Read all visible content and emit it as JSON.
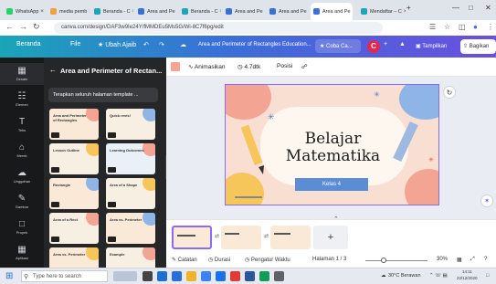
{
  "browser": {
    "tabs": [
      {
        "label": "WhatsApp",
        "color": "#25d366"
      },
      {
        "label": "media pemb",
        "color": "#f2a23a"
      },
      {
        "label": "Beranda - C",
        "color": "#1aa5b8"
      },
      {
        "label": "Area and Pe",
        "color": "#3a6fd8"
      },
      {
        "label": "Beranda - C",
        "color": "#1aa5b8"
      },
      {
        "label": "Area and Pe",
        "color": "#3a6fd8"
      },
      {
        "label": "Area and Pe",
        "color": "#3a6fd8"
      },
      {
        "label": "Area and Pe",
        "color": "#3a6fd8"
      },
      {
        "label": "Mendaftar – C",
        "color": "#1aa5b8"
      }
    ],
    "new_tab": "+",
    "url": "canva.com/design/DAF3w9Ie24Y/fMMDEu5Ms5G/Wi-8C7f6pg/edit"
  },
  "canva_bar": {
    "home": "Beranda",
    "file": "File",
    "resize": "Ubah Ajaib",
    "doc_title": "Area and Perimeter of Rectangles Education...",
    "try_pro": "Coba Ca...",
    "avatar": "C",
    "present": "Tampilkan",
    "share": "Bagikan"
  },
  "rail": [
    {
      "icon": "▦",
      "label": "Desain"
    },
    {
      "icon": "☷",
      "label": "Elemen"
    },
    {
      "icon": "T",
      "label": "Teks"
    },
    {
      "icon": "⌂",
      "label": "Merek"
    },
    {
      "icon": "☁",
      "label": "Unggahan"
    },
    {
      "icon": "✎",
      "label": "Gambar"
    },
    {
      "icon": "□",
      "label": "Proyek"
    },
    {
      "icon": "▦",
      "label": "Aplikasi"
    }
  ],
  "panel": {
    "title": "Area and Perimeter of Rectan...",
    "apply_all": "Terapkan seluruh halaman template ...",
    "thumbs": [
      {
        "title": "Area and Perimeter of Rectangles",
        "bg": "#fbe9d8"
      },
      {
        "title": "Quick revis!",
        "bg": "#f8efe3"
      },
      {
        "title": "Lesson Outline",
        "bg": "#f8efe3"
      },
      {
        "title": "Learning Outcomes",
        "bg": "#e9f0f8"
      },
      {
        "title": "Rectangle",
        "bg": "#fbe9d8"
      },
      {
        "title": "Area of a Shape",
        "bg": "#f8efe3"
      },
      {
        "title": "Area of a Rect",
        "bg": "#f8efe3"
      },
      {
        "title": "Area vs. Perimeter",
        "bg": "#fbe9d8"
      },
      {
        "title": "Area vs. Perimeter",
        "bg": "#fbe9d8"
      },
      {
        "title": "Example",
        "bg": "#f8efe3"
      }
    ]
  },
  "editor_toolbar": {
    "animate": "Animasikan",
    "duration": "4.7dtk",
    "position": "Posisi"
  },
  "slide": {
    "title_line1": "Belajar",
    "title_line2": "Matematika",
    "subtitle": "Kelas 4"
  },
  "pages": {
    "add": "+"
  },
  "status": {
    "notes": "Catatan",
    "duration": "Durasi",
    "timer": "Pengatur Waktu",
    "page": "Halaman 1 / 3",
    "zoom": "30%",
    "zoom_fraction": 0.3
  },
  "taskbar": {
    "search_placeholder": "Type here to search",
    "weather": "30°C  Berawan",
    "time": "14:11",
    "date": "22/12/2020"
  }
}
